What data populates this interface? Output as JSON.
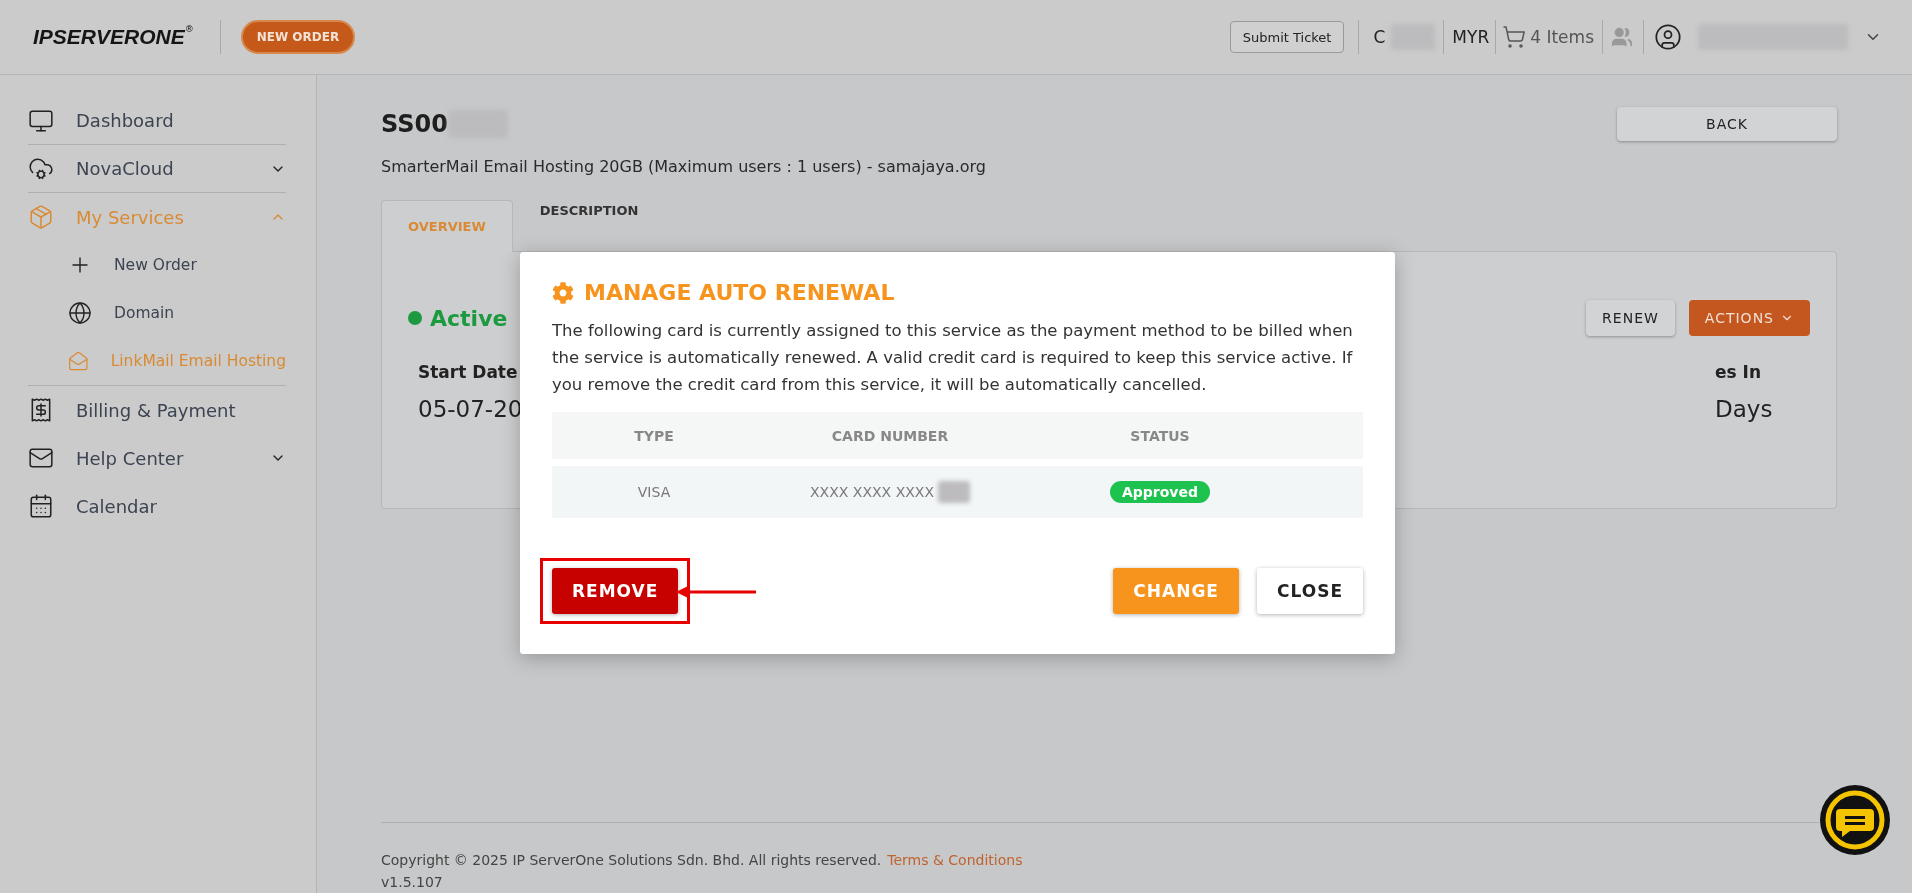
{
  "header": {
    "logo": "IPSERVERONE",
    "logo_mark": "®",
    "new_order": "NEW ORDER",
    "submit_ticket": "Submit Ticket",
    "account_initial": "C",
    "currency": "MYR",
    "cart": "4 Items"
  },
  "sidebar": {
    "items": [
      {
        "label": "Dashboard",
        "kind": "link",
        "selected": false
      },
      {
        "label": "NovaCloud",
        "kind": "group",
        "selected": false,
        "expanded": false
      },
      {
        "label": "My Services",
        "kind": "group",
        "selected": true,
        "expanded": true,
        "children": [
          {
            "label": "New Order",
            "selected": false
          },
          {
            "label": "Domain",
            "selected": false
          },
          {
            "label": "LinkMail Email Hosting",
            "selected": true
          }
        ]
      },
      {
        "label": "Billing & Payment",
        "kind": "link",
        "selected": false
      },
      {
        "label": "Help Center",
        "kind": "group",
        "selected": false,
        "expanded": false
      },
      {
        "label": "Calendar",
        "kind": "link",
        "selected": false
      }
    ]
  },
  "service": {
    "title": "SS00",
    "subtitle": "SmarterMail Email Hosting 20GB (Maximum users : 1 users) - samajaya.org",
    "back": "BACK",
    "tabs": [
      {
        "label": "OVERVIEW",
        "selected": true
      },
      {
        "label": "DESCRIPTION",
        "selected": false
      }
    ],
    "status": "Active",
    "renew": "RENEW",
    "actions": "ACTIONS",
    "fields": [
      {
        "label": "Start Date",
        "value": "05-07-20"
      },
      {
        "label": "es In",
        "value": "Days"
      }
    ]
  },
  "modal": {
    "title": "MANAGE AUTO RENEWAL",
    "body": "The following card is currently assigned to this service as the payment method to be billed when the service is automatically renewed. A valid credit card is required to keep this service active. If you remove the credit card from this service, it will be automatically cancelled.",
    "columns": [
      "TYPE",
      "CARD NUMBER",
      "STATUS"
    ],
    "rows": [
      {
        "type": "VISA",
        "card_number": "XXXX XXXX XXXX",
        "status": "Approved"
      }
    ],
    "buttons": [
      {
        "label": "REMOVE",
        "kind": "danger",
        "highlighted": true
      },
      {
        "label": "CHANGE",
        "kind": "primary",
        "highlighted": false
      },
      {
        "label": "CLOSE",
        "kind": "secondary",
        "highlighted": false
      }
    ]
  },
  "footer": {
    "copyright": "Copyright © 2025 IP ServerOne Solutions Sdn. Bhd. All rights reserved.",
    "terms": "Terms & Conditions",
    "version": "v1.5.107"
  }
}
